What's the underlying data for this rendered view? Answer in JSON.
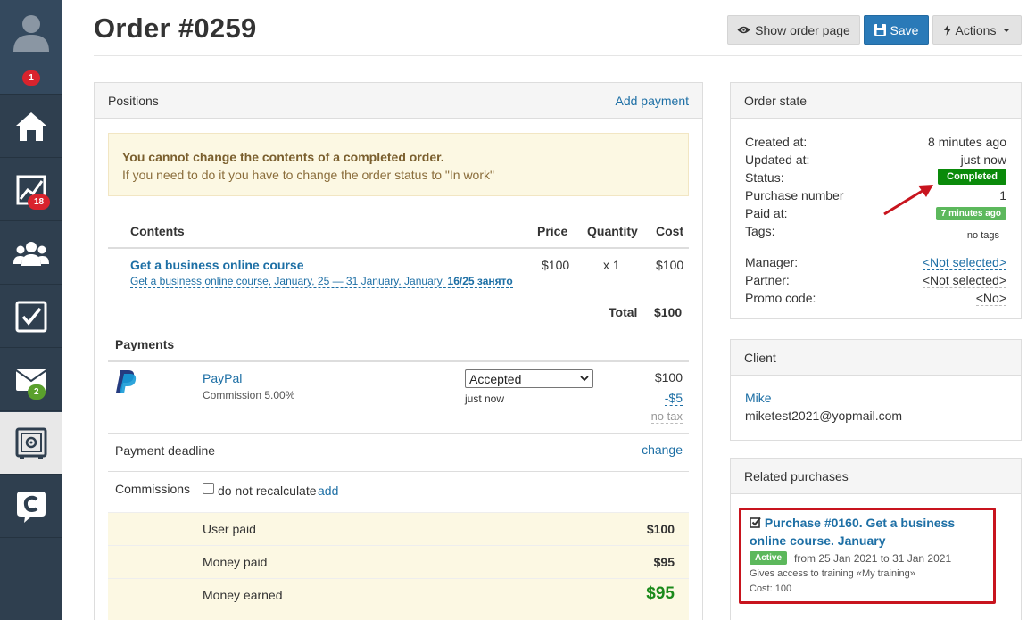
{
  "sidebar": {
    "notifications_badge": "1",
    "stats_badge": "18",
    "messages_badge": "2"
  },
  "header": {
    "title": "Order #0259",
    "show_order_page": "Show order page",
    "save": "Save",
    "actions": "Actions"
  },
  "positions": {
    "title": "Positions",
    "add_payment": "Add payment",
    "alert_title": "You cannot change the contents of a completed order.",
    "alert_text": "If you need to do it you have to change the order status to \"In work\"",
    "columns": {
      "contents": "Contents",
      "price": "Price",
      "quantity": "Quantity",
      "cost": "Cost"
    },
    "item": {
      "name": "Get a business online course",
      "subtitle": "Get a business online course, January, 25 — 31 January, January,",
      "seats": "16/25 занято",
      "price": "$100",
      "quantity": "x 1",
      "cost": "$100"
    },
    "total_label": "Total",
    "total_value": "$100"
  },
  "payments": {
    "title": "Payments",
    "method": "PayPal",
    "commission": "Commission 5.00%",
    "status_selected": "Accepted",
    "time": "just now",
    "amount": "$100",
    "fee": "-$5",
    "tax": "no tax"
  },
  "deadline": {
    "label": "Payment deadline",
    "change": "change"
  },
  "commissions": {
    "label": "Commissions",
    "checkbox_label": "do not recalculate",
    "add": "add"
  },
  "summary": [
    {
      "label": "User paid",
      "value": "$100"
    },
    {
      "label": "Money paid",
      "value": "$95"
    },
    {
      "label": "Money earned",
      "value": "$95"
    }
  ],
  "order_state": {
    "title": "Order state",
    "created_label": "Created at:",
    "created_value": "8 minutes ago",
    "updated_label": "Updated at:",
    "updated_value": "just now",
    "status_label": "Status:",
    "status_value": "Completed",
    "purchase_label": "Purchase number",
    "purchase_value": "1",
    "paid_label": "Paid at:",
    "paid_value": "7 minutes ago",
    "tags_label": "Tags:",
    "tags_value": "no tags",
    "manager_label": "Manager:",
    "manager_value": "<Not selected>",
    "partner_label": "Partner:",
    "partner_value": "<Not selected>",
    "promo_label": "Promo code:",
    "promo_value": "<No>"
  },
  "client": {
    "title": "Client",
    "name": "Mike",
    "email": "miketest2021@yopmail.com"
  },
  "related": {
    "title": "Related purchases",
    "purchase_title": "Purchase #0160. Get a business online course. January",
    "status": "Active",
    "dates": "from 25 Jan 2021 to 31 Jan 2021",
    "access": "Gives access to training «My training»",
    "cost": "Cost: 100"
  },
  "colors": {
    "sidebar": "#2f3f4f",
    "primary": "#2a7ab8",
    "link": "#1d6fa5",
    "completed": "#0a8a0a",
    "active": "#5cb85c",
    "highlight": "#c8141e",
    "earned": "#1b8a1b"
  }
}
